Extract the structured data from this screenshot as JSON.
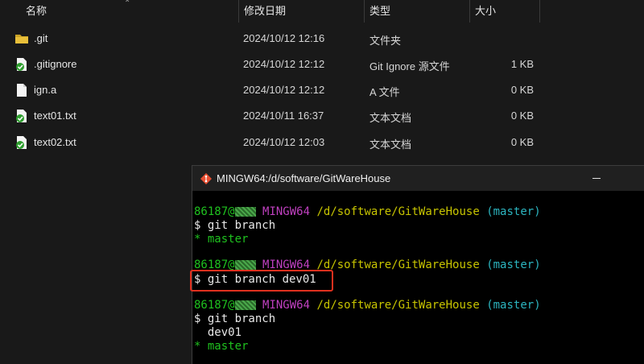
{
  "explorer": {
    "columns": {
      "name": "名称",
      "date": "修改日期",
      "type": "类型",
      "size": "大小"
    },
    "files": [
      {
        "name": ".git",
        "date": "2024/10/12 12:16",
        "type": "文件夹",
        "size": "",
        "icon": "folder-icon"
      },
      {
        "name": ".gitignore",
        "date": "2024/10/12 12:12",
        "type": "Git Ignore 源文件",
        "size": "1 KB",
        "icon": "git-file-icon"
      },
      {
        "name": "ign.a",
        "date": "2024/10/12 12:12",
        "type": "A 文件",
        "size": "0 KB",
        "icon": "blank-file-icon"
      },
      {
        "name": "text01.txt",
        "date": "2024/10/11 16:37",
        "type": "文本文档",
        "size": "0 KB",
        "icon": "git-file-icon"
      },
      {
        "name": "text02.txt",
        "date": "2024/10/12 12:03",
        "type": "文本文档",
        "size": "0 KB",
        "icon": "git-file-icon"
      }
    ]
  },
  "terminal": {
    "title": "MINGW64:/d/software/GitWareHouse",
    "prompt": {
      "user": "86187@",
      "system": "MINGW64",
      "path": "/d/software/GitWareHouse",
      "branch": "(master)"
    },
    "commands": [
      "$ git branch",
      "$ git branch dev01",
      "$ git branch"
    ],
    "outputs": {
      "master_star": "* master",
      "dev01": "  dev01"
    },
    "colors": {
      "green": "#1fc21f",
      "magenta": "#bf40bf",
      "yellow": "#c7c400",
      "cyan": "#2cb5c0",
      "highlight": "#e0301e"
    }
  }
}
